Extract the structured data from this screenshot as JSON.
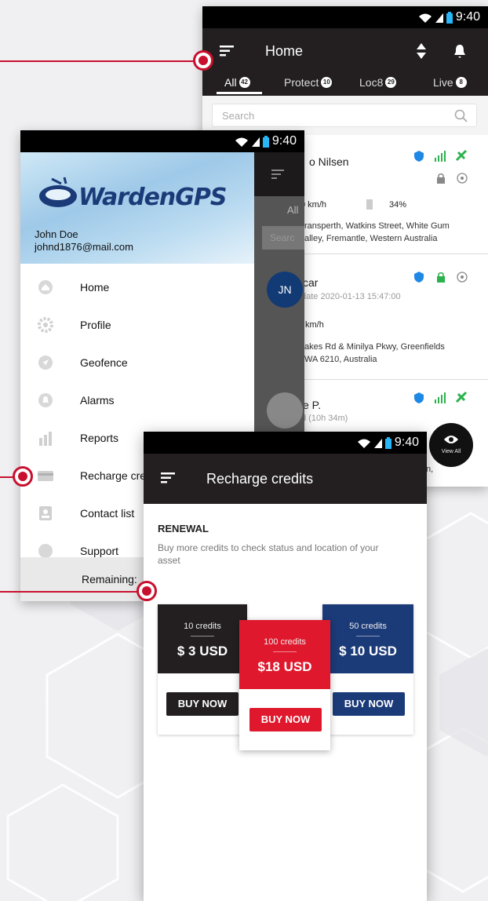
{
  "status_bar": {
    "time": "9:40"
  },
  "home": {
    "title": "Home",
    "tabs": [
      {
        "label": "All",
        "count": "42"
      },
      {
        "label": "Protect",
        "count": "10"
      },
      {
        "label": "Loc8",
        "count": "29"
      },
      {
        "label": "Live",
        "count": "8"
      }
    ],
    "search_placeholder": "Search",
    "cards": [
      {
        "name": "o Nilsen",
        "speed": "0 km/h",
        "battery": "34%",
        "address_1": "ransperth, Watkins Street, White Gum",
        "address_2": "alley, Fremantle, Western Australia"
      },
      {
        "avatar": "JN",
        "name": "car",
        "last_update": "date 2020-01-13 15:47:00",
        "speed": "km/h",
        "address_1": "akes Rd & Minilya Pkwy, Greenfields",
        "address_2": "WA 6210, Australia"
      },
      {
        "name": "e P.",
        "duration": "d (10h 34m)",
        "address_tail": "n,"
      }
    ],
    "view_all": "View All"
  },
  "drawer": {
    "brand": "WardenGPS",
    "user_name": "John Doe",
    "user_email": "johnd1876@mail.com",
    "items": [
      {
        "label": "Home"
      },
      {
        "label": "Profile"
      },
      {
        "label": "Geofence"
      },
      {
        "label": "Alarms"
      },
      {
        "label": "Reports"
      },
      {
        "label": "Recharge cre"
      },
      {
        "label": "Contact list"
      },
      {
        "label": "Support"
      }
    ],
    "remaining_label": "Remaining:",
    "underlay_tab": "All",
    "underlay_search": "Searc"
  },
  "recharge": {
    "title": "Recharge credits",
    "section_title": "RENEWAL",
    "section_desc": "Buy more credits to check status and location of your asset",
    "plans": [
      {
        "credits": "10 credits",
        "price": "$ 3 USD",
        "button": "BUY NOW"
      },
      {
        "credits": "100 credits",
        "price": "$18 USD",
        "button": "BUY NOW"
      },
      {
        "credits": "50 credits",
        "price": "$ 10 USD",
        "button": "BUY NOW"
      }
    ]
  },
  "colors": {
    "dark": "#231f20",
    "accent_red": "#e0182d",
    "navy": "#1b3a78",
    "black_plan": "#231f20",
    "green": "#2bb24c",
    "blue_icon": "#1e88e5"
  }
}
